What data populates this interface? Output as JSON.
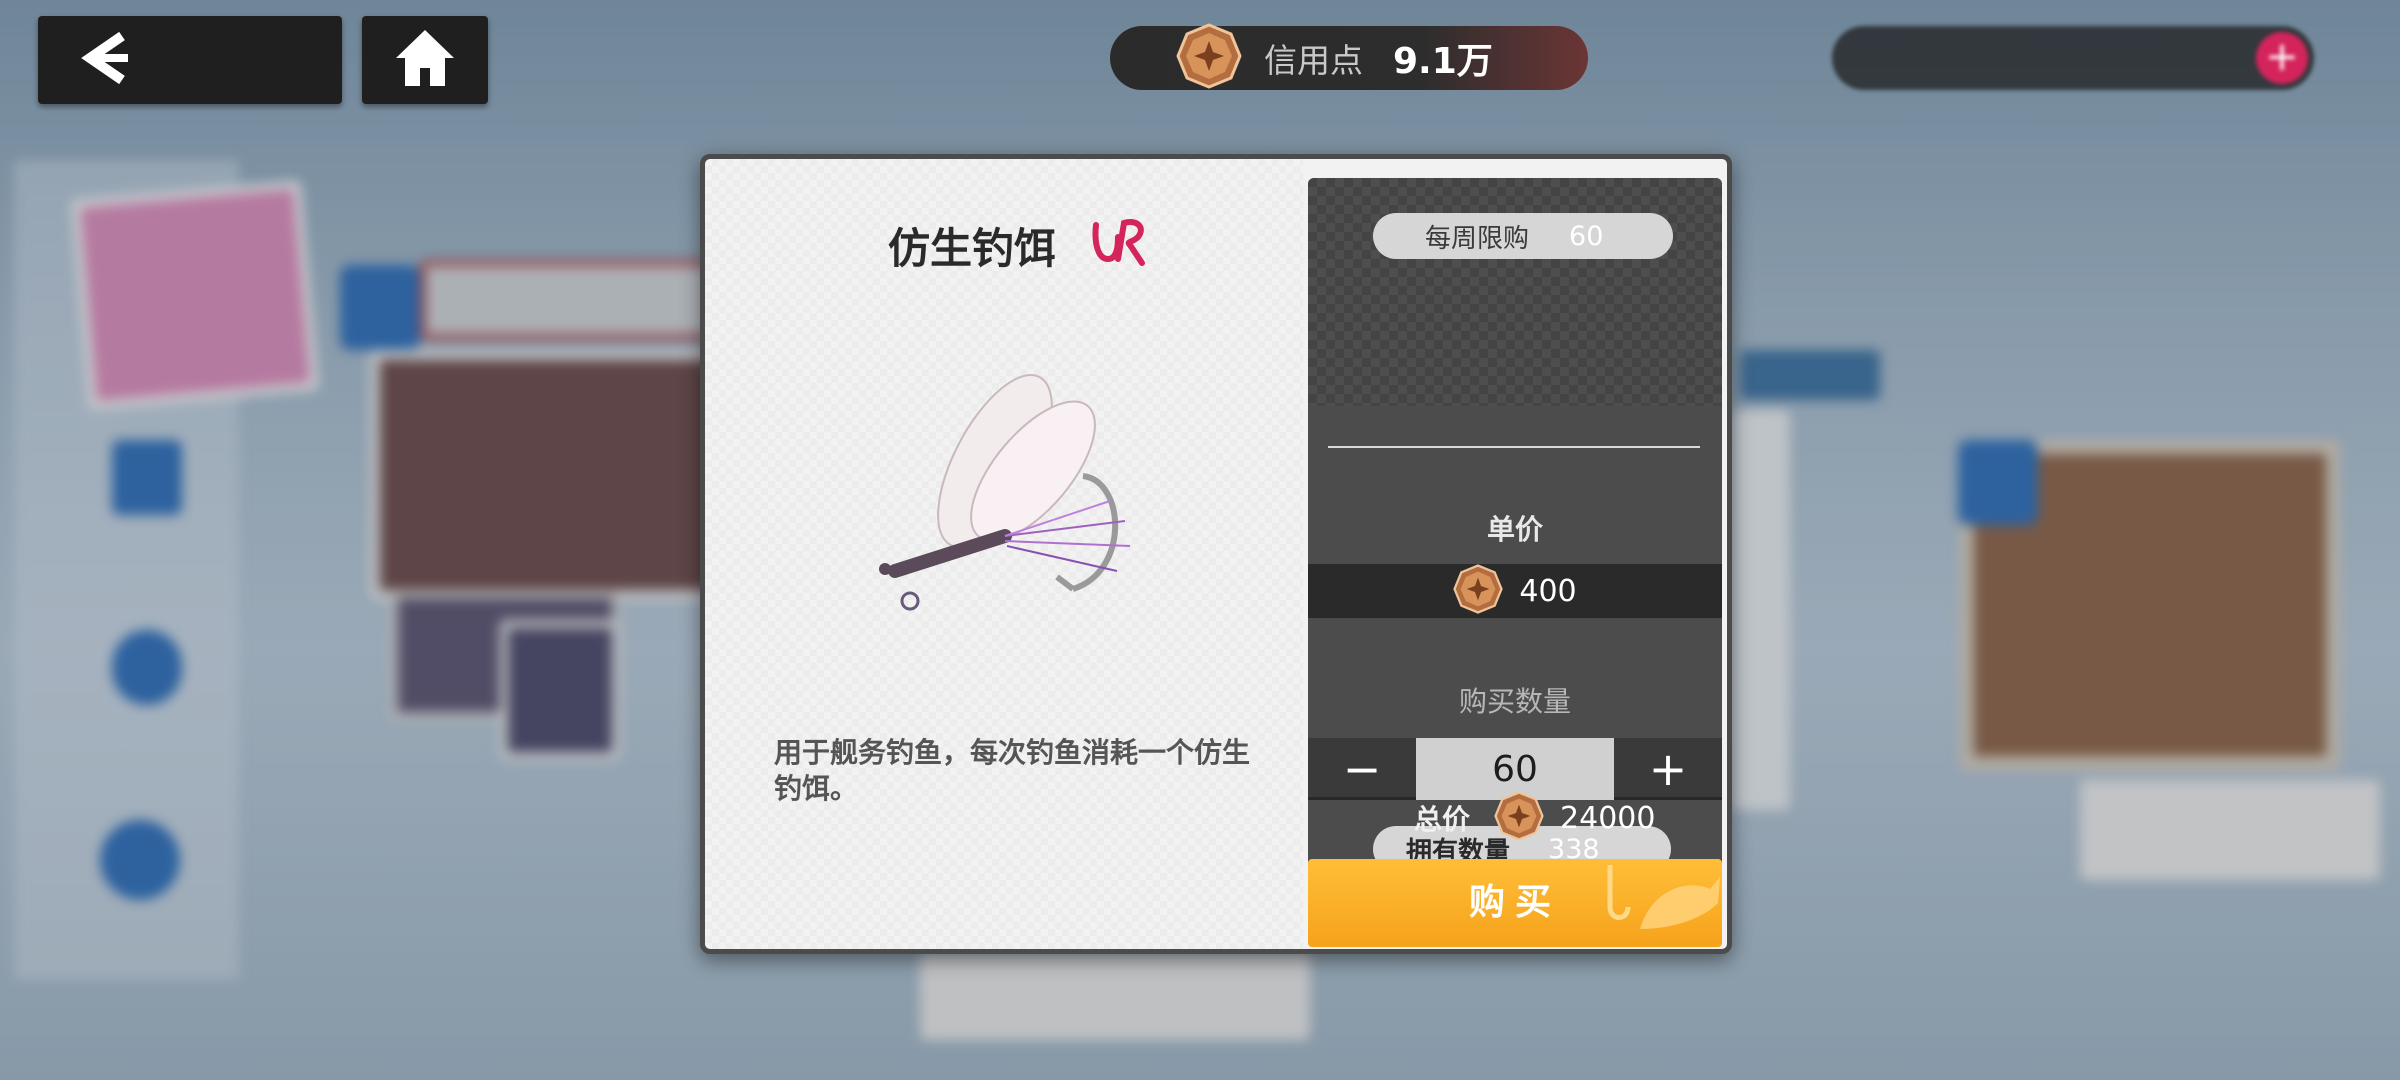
{
  "top_bar": {
    "credit_label": "信用点",
    "credit_value": "9.1万"
  },
  "item": {
    "name": "仿生钓饵",
    "rarity": "UR",
    "description": "用于舰务钓鱼，每次钓鱼消耗一个仿生钓饵。"
  },
  "purchase": {
    "weekly_limit_label": "每周限购",
    "weekly_limit_value": "60",
    "unit_price_label": "单价",
    "unit_price_value": "400",
    "quantity_label": "购买数量",
    "quantity_value": "60",
    "minus_symbol": "−",
    "plus_symbol": "+",
    "owned_label": "拥有数量",
    "owned_value": "338",
    "total_label": "总价",
    "total_value": "24000",
    "buy_label": "购买"
  },
  "colors": {
    "accent": "#f6a21b",
    "rarity": "#d4245b",
    "panel": "#4c4c4c"
  },
  "icons": [
    "back-arrow-icon",
    "home-icon",
    "credit-coin-icon",
    "ur-rarity-icon",
    "fish-hook-icon",
    "fish-icon"
  ]
}
